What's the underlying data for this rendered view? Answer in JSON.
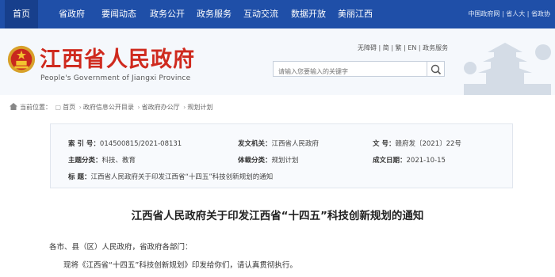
{
  "topnav": {
    "items": [
      "首页",
      "省政府",
      "要闻动态",
      "政务公开",
      "政务服务",
      "互动交流",
      "数据开放",
      "美丽江西"
    ],
    "right_links": "中国政府网 | 省人大 | 省政协"
  },
  "header": {
    "title": "江西省人民政府",
    "subtitle": "People's Government of Jiangxi Province",
    "links": "无障碍 | 简 | 繁 | EN | 政务服务",
    "search_placeholder": "请输入您要输入的关键字"
  },
  "breadcrumb": {
    "label": "当前位置：",
    "items": [
      "首页",
      "政府信息公开目录",
      "省政府办公厅",
      "规划计划"
    ]
  },
  "meta": {
    "index_label": "索  引  号：",
    "index_value": "014500815/2021-08131",
    "issuer_label": "发文机关：",
    "issuer_value": "江西省人民政府",
    "doc_no_label": "文    号：",
    "doc_no_value": "赣府发〔2021〕22号",
    "topic_label": "主题分类：",
    "topic_value": "科技、教育",
    "type_label": "体裁分类：",
    "type_value": "规划计划",
    "date_label": "成文日期：",
    "date_value": "2021-10-15",
    "title_label": "标    题：",
    "title_value": "江西省人民政府关于印发江西省“十四五”科技创新规划的通知"
  },
  "document": {
    "title": "江西省人民政府关于印发江西省“十四五”科技创新规划的通知",
    "p1": "各市、县（区）人民政府，省政府各部门：",
    "p2": "现将《江西省“十四五”科技创新规划》印发给你们，请认真贯彻执行。"
  },
  "colors": {
    "nav": "#1f4fa8",
    "title_red": "#cf2a1e"
  }
}
